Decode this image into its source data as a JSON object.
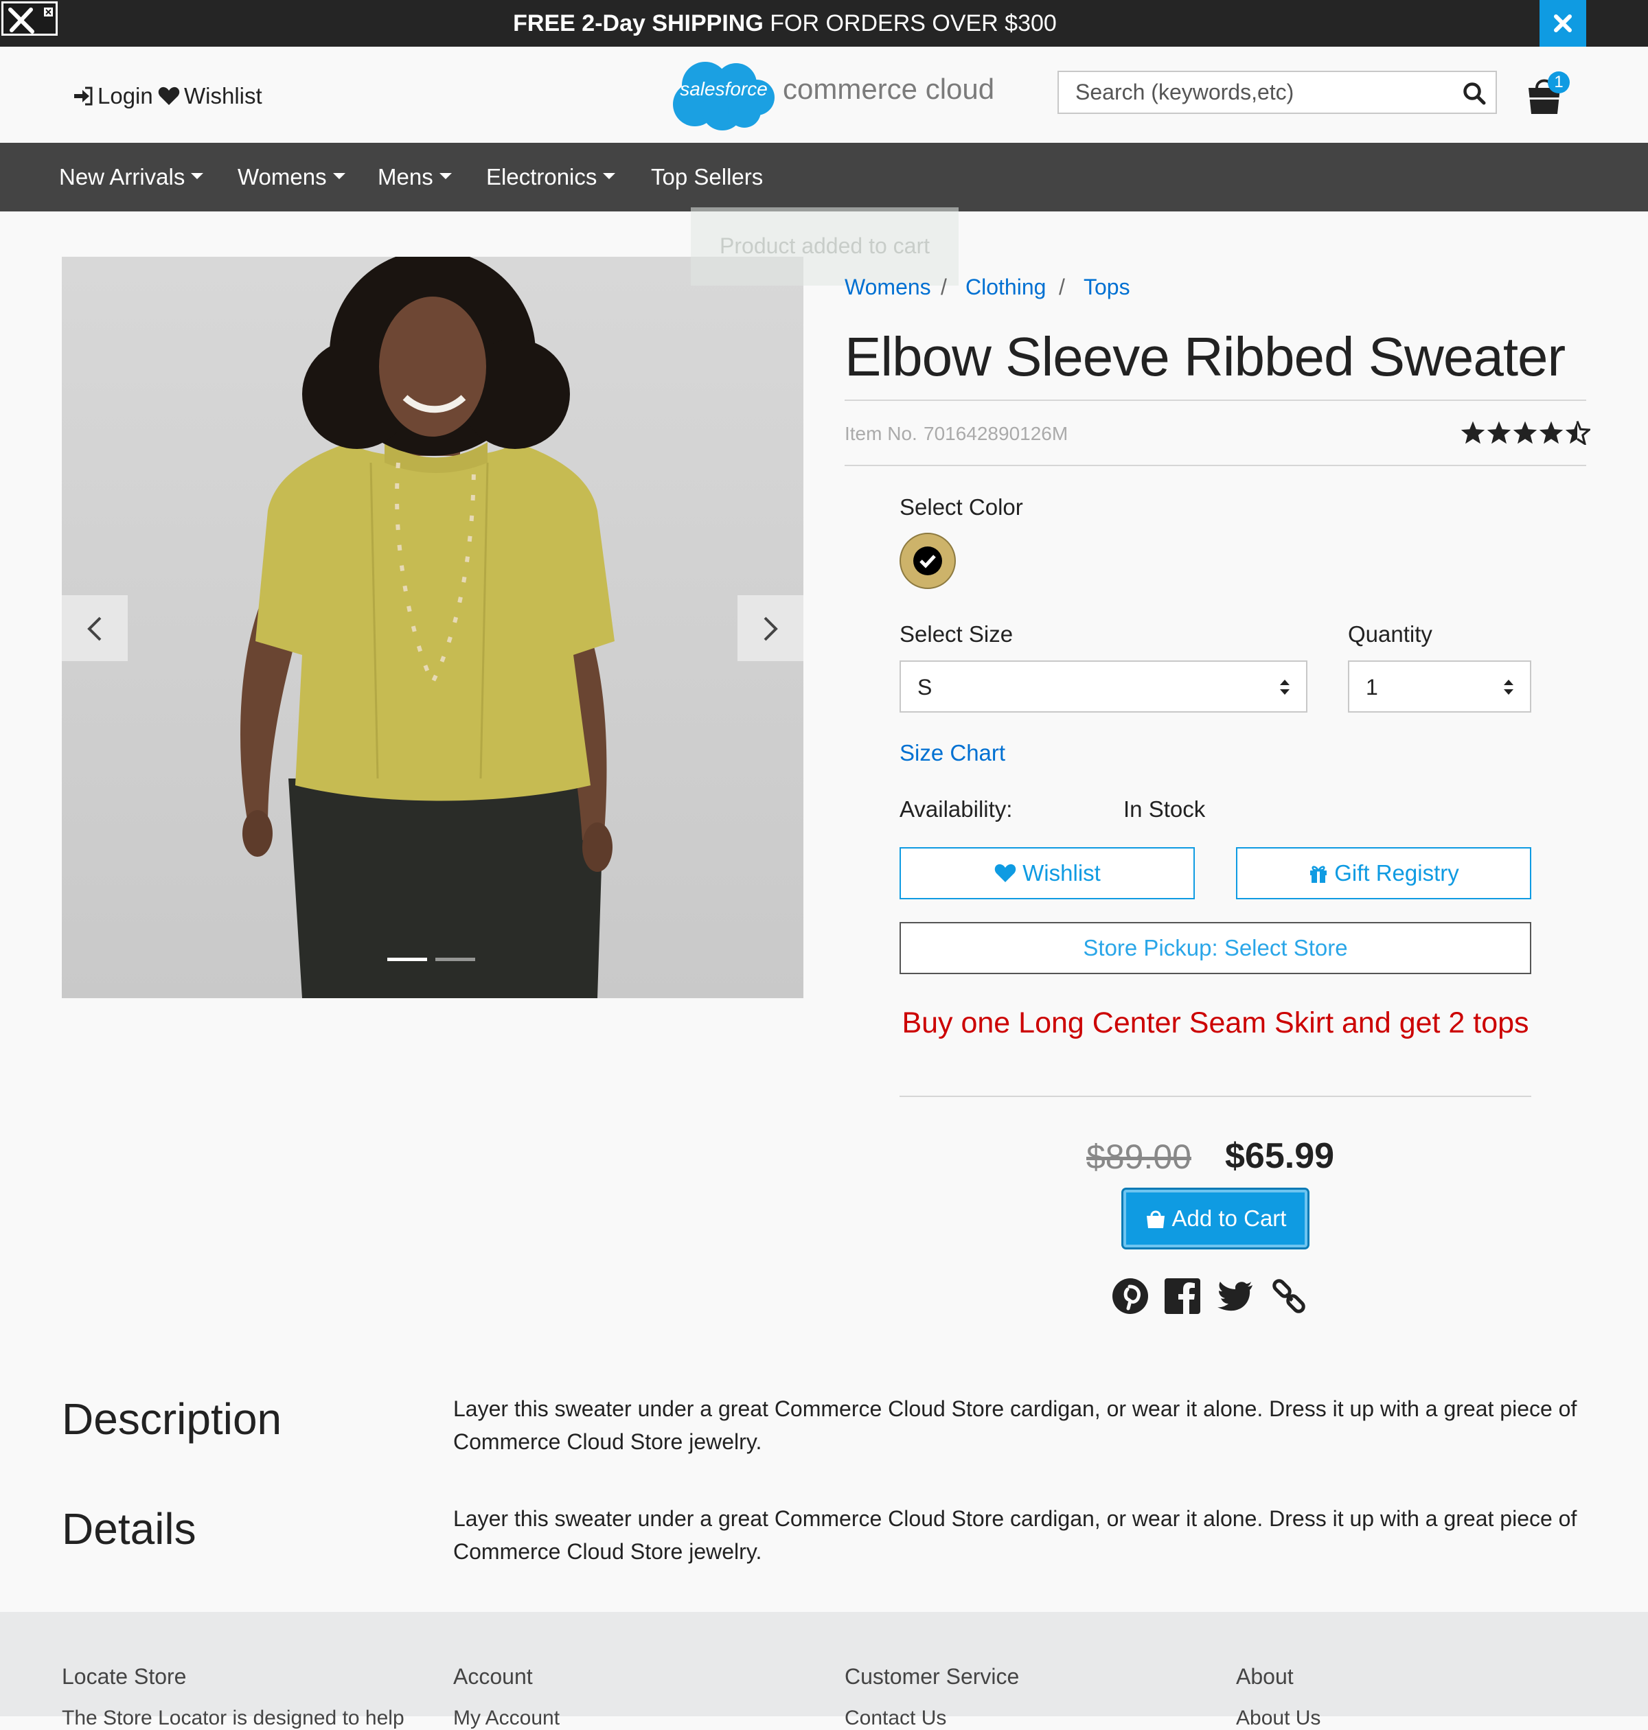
{
  "promo_banner": {
    "free_label": "FREE 2-Day SHIPPING",
    "rest_label": " FOR ORDERS OVER $300"
  },
  "header": {
    "login": "Login",
    "wishlist": "Wishlist",
    "logo_cloud_text": "salesforce",
    "logo_text": "commerce cloud",
    "search_placeholder": "Search (keywords,etc)",
    "cart_count": "1"
  },
  "nav": [
    {
      "label": "New Arrivals"
    },
    {
      "label": "Womens"
    },
    {
      "label": "Mens"
    },
    {
      "label": "Electronics"
    },
    {
      "label": "Top Sellers"
    }
  ],
  "toast": "Product added to cart",
  "breadcrumb": [
    "Womens",
    "Clothing",
    "Tops"
  ],
  "breadcrumb_sep": "/",
  "product": {
    "name": "Elbow Sleeve Ribbed Sweater",
    "item_no_label": "Item No.",
    "item_no": "701642890126M",
    "rating": 4.5,
    "select_color_label": "Select Color",
    "select_size_label": "Select Size",
    "size_value": "S",
    "quantity_label": "Quantity",
    "quantity_value": "1",
    "size_chart": "Size Chart",
    "availability_label": "Availability:",
    "availability_value": "In Stock",
    "wishlist_btn": "Wishlist",
    "gift_registry_btn": "Gift Registry",
    "store_pickup_btn": "Store Pickup: Select Store",
    "promo_callout": "Buy one Long Center Seam Skirt and get 2 tops",
    "old_price": "$89.00",
    "new_price": "$65.99",
    "add_to_cart": "Add to Cart",
    "colors": {
      "accent": "#0f9be2",
      "link": "#0070d2",
      "promo": "#cc0000",
      "swatch": "#cdb36a"
    }
  },
  "description": {
    "title": "Description",
    "body": "Layer this sweater under a great Commerce Cloud Store cardigan, or wear it alone. Dress it up with a great piece of Commerce Cloud Store jewelry."
  },
  "details": {
    "title": "Details",
    "body": "Layer this sweater under a great Commerce Cloud Store cardigan, or wear it alone. Dress it up with a great piece of Commerce Cloud Store jewelry."
  },
  "footer": [
    {
      "heading": "Locate Store",
      "first": "The Store Locator is designed to help"
    },
    {
      "heading": "Account",
      "first": "My Account"
    },
    {
      "heading": "Customer Service",
      "first": "Contact Us"
    },
    {
      "heading": "About",
      "first": "About Us"
    }
  ],
  "icons": [
    "tools-icon",
    "close-icon",
    "login-icon",
    "heart-icon",
    "search-icon",
    "cart-icon",
    "chevron-left-icon",
    "chevron-right-icon",
    "star-icon",
    "star-half-icon",
    "check-icon",
    "sort-arrows-icon",
    "gift-icon",
    "shopping-bag-icon",
    "pinterest-icon",
    "facebook-icon",
    "twitter-icon",
    "link-icon"
  ]
}
